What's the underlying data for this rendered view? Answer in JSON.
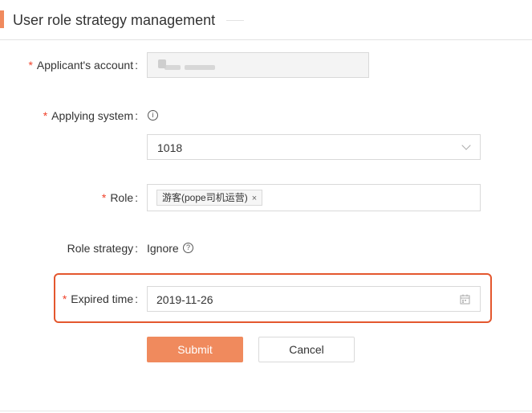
{
  "header": {
    "title": "User role strategy management"
  },
  "form": {
    "applicant_account": {
      "label": "Applicant's account",
      "required": true,
      "value": ""
    },
    "applying_system": {
      "label": "Applying system",
      "required": true,
      "value": "1018",
      "info_icon": "info-circle-icon",
      "dropdown_icon": "chevron-down-icon"
    },
    "role": {
      "label": "Role",
      "required": true,
      "tags": [
        {
          "label": "游客(pope司机运营)",
          "close": "×"
        }
      ]
    },
    "role_strategy": {
      "label": "Role strategy",
      "required": false,
      "value": "Ignore",
      "help_icon": "question-circle-icon"
    },
    "expired_time": {
      "label": "Expired time",
      "required": true,
      "value": "2019-11-26",
      "calendar_icon": "calendar-icon"
    },
    "colon": ":"
  },
  "actions": {
    "submit_label": "Submit",
    "cancel_label": "Cancel"
  },
  "colors": {
    "accent": "#f08a5d",
    "required_star": "#f0412a",
    "highlight_border": "#e4572e"
  }
}
